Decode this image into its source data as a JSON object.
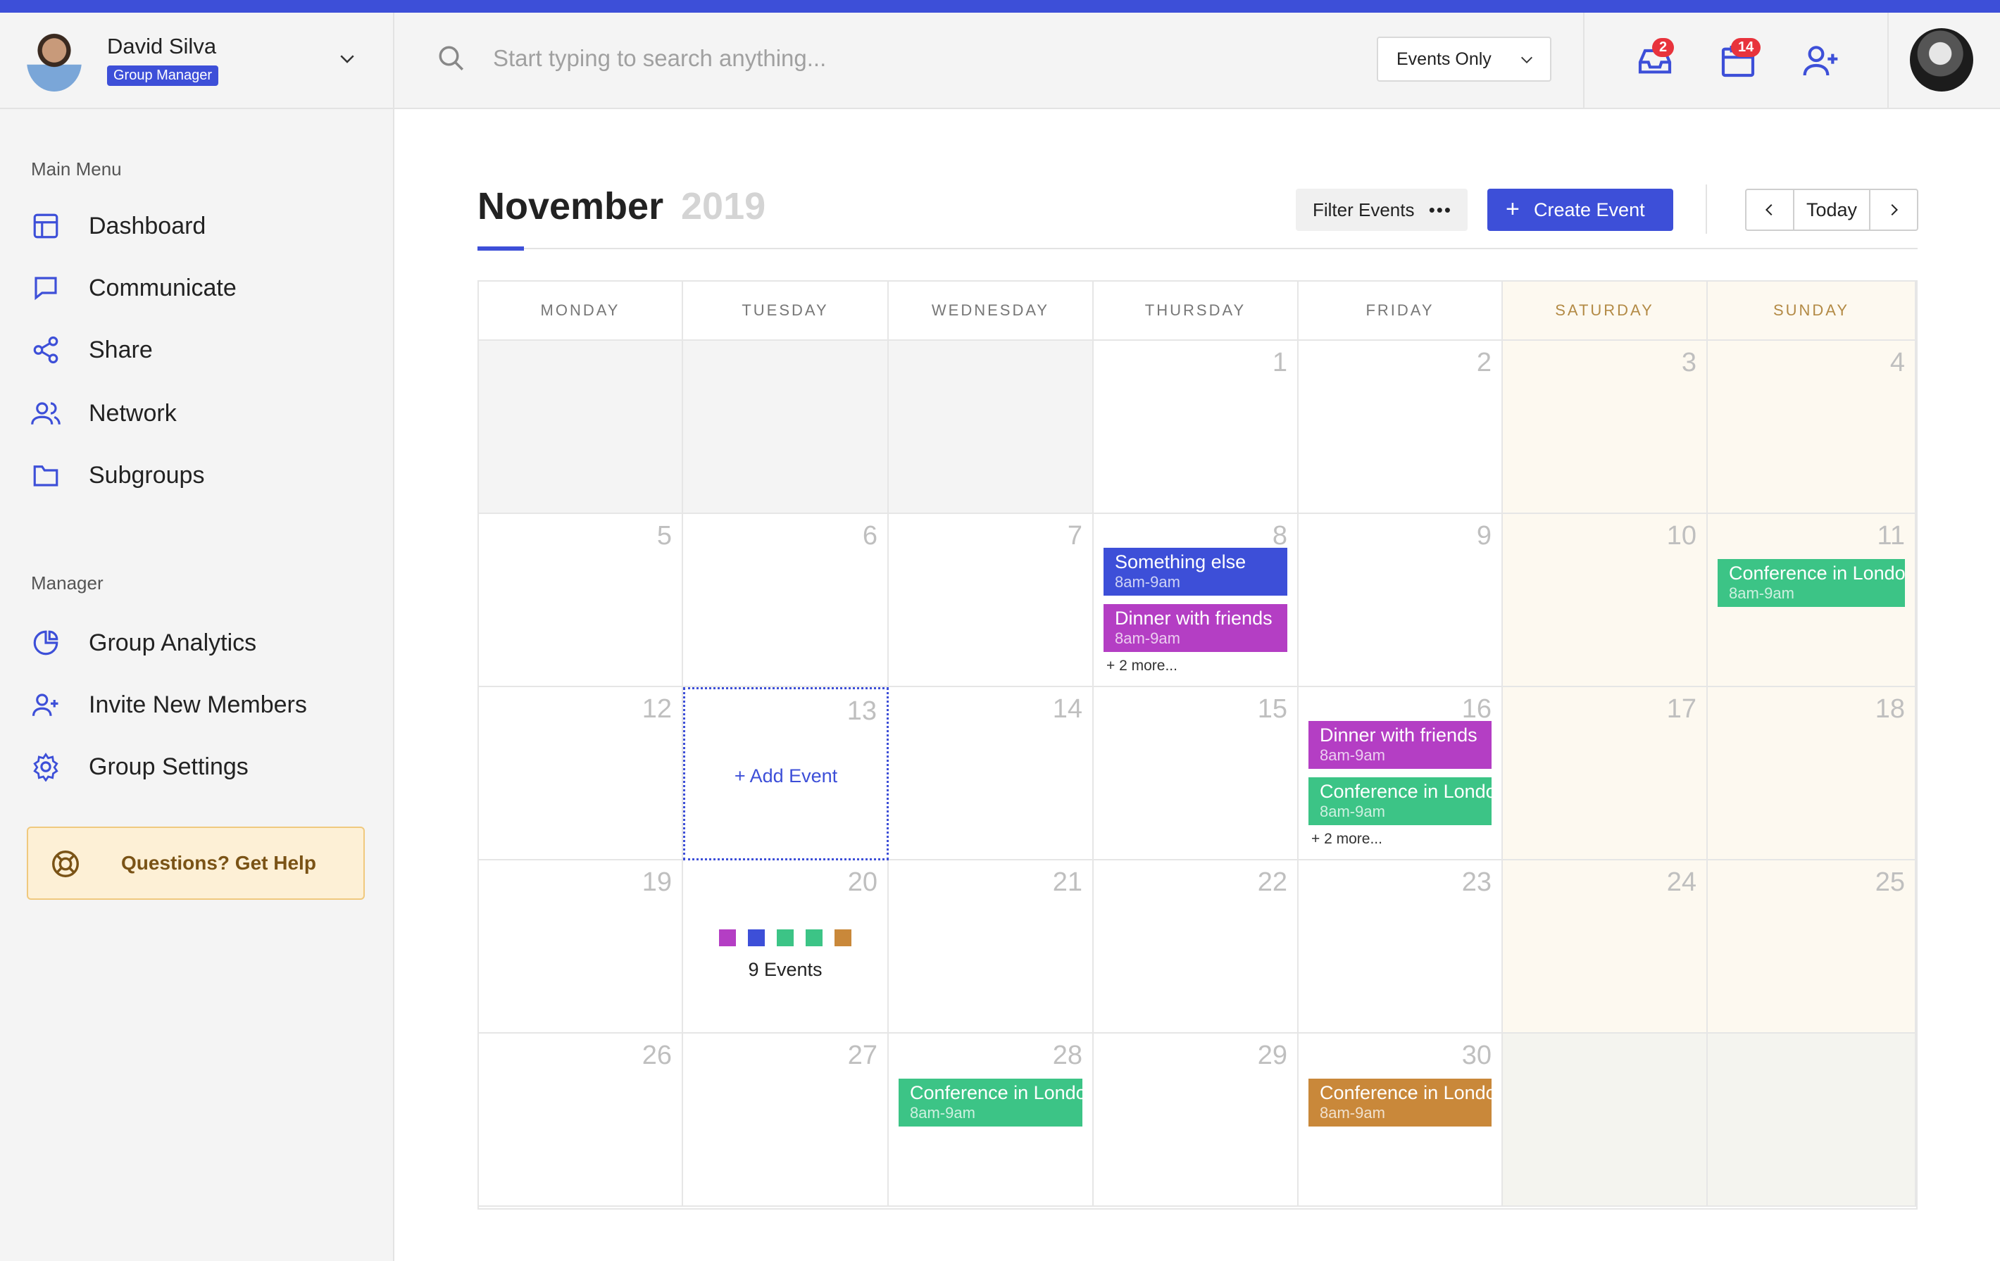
{
  "user": {
    "name": "David Silva",
    "role": "Group Manager"
  },
  "search": {
    "placeholder": "Start typing to search anything..."
  },
  "filter_select": {
    "value": "Events Only"
  },
  "notifications": {
    "inbox_count": "2",
    "calendar_count": "14"
  },
  "sidebar": {
    "main_heading": "Main Menu",
    "main_items": [
      {
        "label": "Dashboard",
        "icon": "layout-icon"
      },
      {
        "label": "Communicate",
        "icon": "chat-icon"
      },
      {
        "label": "Share",
        "icon": "share-icon"
      },
      {
        "label": "Network",
        "icon": "users-icon"
      },
      {
        "label": "Subgroups",
        "icon": "folder-icon"
      }
    ],
    "manager_heading": "Manager",
    "manager_items": [
      {
        "label": "Group Analytics",
        "icon": "pie-chart-icon"
      },
      {
        "label": "Invite New Members",
        "icon": "user-plus-icon"
      },
      {
        "label": "Group Settings",
        "icon": "gear-icon"
      }
    ],
    "help": "Questions? Get Help"
  },
  "calendar": {
    "month": "November",
    "year": "2019",
    "filter_label": "Filter Events",
    "create_label": "Create Event",
    "today_label": "Today",
    "add_event_label": "Add Event",
    "days": [
      "MONDAY",
      "TUESDAY",
      "WEDNESDAY",
      "THURSDAY",
      "FRIDAY",
      "SATURDAY",
      "SUNDAY"
    ],
    "colors": {
      "blue": "#3d4fd8",
      "purple": "#b43ec4",
      "green": "#3cc486",
      "orange": "#c9883a"
    },
    "weeks": [
      [
        null,
        null,
        null,
        {
          "d": "1"
        },
        {
          "d": "2"
        },
        {
          "d": "3"
        },
        {
          "d": "4"
        }
      ],
      [
        {
          "d": "5"
        },
        {
          "d": "6"
        },
        {
          "d": "7"
        },
        {
          "d": "8",
          "events": [
            {
              "title": "Something else",
              "time": "8am-9am",
              "color": "blue"
            },
            {
              "title": "Dinner with friends",
              "time": "8am-9am",
              "color": "purple"
            }
          ],
          "more": "+ 2 more..."
        },
        {
          "d": "9"
        },
        {
          "d": "10"
        },
        {
          "d": "11",
          "events": [
            {
              "title": "Conference in London",
              "time": "8am-9am",
              "color": "green"
            }
          ]
        }
      ],
      [
        {
          "d": "12"
        },
        {
          "d": "13",
          "add": true
        },
        {
          "d": "14"
        },
        {
          "d": "15"
        },
        {
          "d": "16",
          "events": [
            {
              "title": "Dinner with friends",
              "time": "8am-9am",
              "color": "purple"
            },
            {
              "title": "Conference in London",
              "time": "8am-9am",
              "color": "green"
            }
          ],
          "more": "+ 2 more..."
        },
        {
          "d": "17"
        },
        {
          "d": "18"
        }
      ],
      [
        {
          "d": "19"
        },
        {
          "d": "20",
          "swatches": [
            "purple",
            "blue",
            "green",
            "green",
            "orange"
          ],
          "count": "9 Events"
        },
        {
          "d": "21"
        },
        {
          "d": "22"
        },
        {
          "d": "23"
        },
        {
          "d": "24"
        },
        {
          "d": "25"
        }
      ],
      [
        {
          "d": "26"
        },
        {
          "d": "27"
        },
        {
          "d": "28",
          "events": [
            {
              "title": "Conference in London",
              "time": "8am-9am",
              "color": "green"
            }
          ]
        },
        {
          "d": "29"
        },
        {
          "d": "30",
          "events": [
            {
              "title": "Conference in London",
              "time": "8am-9am",
              "color": "orange"
            }
          ]
        },
        null,
        null
      ]
    ]
  }
}
